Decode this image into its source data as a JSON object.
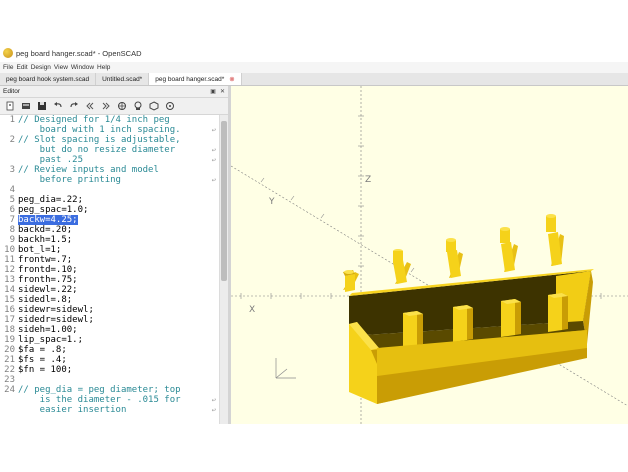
{
  "window": {
    "title": "peg board hanger.scad* - OpenSCAD"
  },
  "menu": [
    "File",
    "Edit",
    "Design",
    "View",
    "Window",
    "Help"
  ],
  "tabs": [
    {
      "label": "peg board hook system.scad",
      "active": false
    },
    {
      "label": "Untitled.scad*",
      "active": false
    },
    {
      "label": "peg board hanger.scad*",
      "active": true
    }
  ],
  "editor": {
    "title": "Editor",
    "header_buttons": [
      "▣",
      "✕"
    ],
    "toolbar_icons": [
      "new-file-icon",
      "open-file-icon",
      "save-icon",
      "undo-icon",
      "redo-icon",
      "unindent-icon",
      "indent-icon",
      "preview-icon",
      "render-icon",
      "export-stl-icon",
      "customizer-icon"
    ],
    "lines": [
      {
        "n": "1",
        "text": "// Designed for 1/4 inch peg",
        "type": "comment"
      },
      {
        "n": "",
        "text": "    board with 1 inch spacing.",
        "type": "comment",
        "wrap": true
      },
      {
        "n": "2",
        "text": "// Slot spacing is adjustable,",
        "type": "comment"
      },
      {
        "n": "",
        "text": "    but do no resize diameter",
        "type": "comment",
        "wrap": true
      },
      {
        "n": "",
        "text": "    past .25",
        "type": "comment",
        "wrap": true
      },
      {
        "n": "3",
        "text": "// Review inputs and model",
        "type": "comment"
      },
      {
        "n": "",
        "text": "    before printing",
        "type": "comment",
        "wrap": true
      },
      {
        "n": "4",
        "text": "",
        "type": "code"
      },
      {
        "n": "5",
        "text": "peg_dia=.22;",
        "type": "code"
      },
      {
        "n": "6",
        "text": "peg_spac=1.0;",
        "type": "code"
      },
      {
        "n": "7",
        "text": "backw=4.25;",
        "type": "code",
        "highlight": true
      },
      {
        "n": "8",
        "text": "backd=.20;",
        "type": "code"
      },
      {
        "n": "9",
        "text": "backh=1.5;",
        "type": "code"
      },
      {
        "n": "10",
        "text": "bot_l=1;",
        "type": "code"
      },
      {
        "n": "11",
        "text": "frontw=.7;",
        "type": "code"
      },
      {
        "n": "12",
        "text": "frontd=.10;",
        "type": "code"
      },
      {
        "n": "13",
        "text": "fronth=.75;",
        "type": "code"
      },
      {
        "n": "14",
        "text": "sidewl=.22;",
        "type": "code"
      },
      {
        "n": "15",
        "text": "sidedl=.8;",
        "type": "code"
      },
      {
        "n": "16",
        "text": "sidewr=sidewl;",
        "type": "code"
      },
      {
        "n": "17",
        "text": "sidedr=sidewl;",
        "type": "code"
      },
      {
        "n": "18",
        "text": "sideh=1.00;",
        "type": "code"
      },
      {
        "n": "19",
        "text": "lip_spac=1.;",
        "type": "code"
      },
      {
        "n": "20",
        "text": "$fa = .8;",
        "type": "code"
      },
      {
        "n": "21",
        "text": "$fs = .4;",
        "type": "code"
      },
      {
        "n": "22",
        "text": "$fn = 100;",
        "type": "code"
      },
      {
        "n": "23",
        "text": "",
        "type": "code"
      },
      {
        "n": "24",
        "text": "// peg_dia = peg diameter; top",
        "type": "comment"
      },
      {
        "n": "",
        "text": "    is the diameter - .015 for",
        "type": "comment",
        "wrap": true
      },
      {
        "n": "",
        "text": "    easier insertion",
        "type": "comment",
        "wrap": true
      }
    ]
  },
  "viewport": {
    "axis_labels": [
      "Z",
      "X",
      "Y",
      "Y"
    ],
    "model_color": "#f5d21a",
    "background_color": "#ffffe5",
    "peg_count": 5,
    "lip_count": 4
  }
}
